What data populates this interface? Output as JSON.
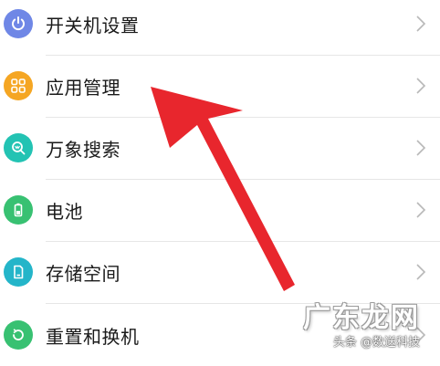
{
  "settings": {
    "items": [
      {
        "label": "开关机设置",
        "icon": "power-icon",
        "color": "#6f87e6"
      },
      {
        "label": "应用管理",
        "icon": "apps-grid-icon",
        "color": "#f5a623"
      },
      {
        "label": "万象搜索",
        "icon": "search-icon",
        "color": "#23c3b3"
      },
      {
        "label": "电池",
        "icon": "battery-icon",
        "color": "#38c172"
      },
      {
        "label": "存储空间",
        "icon": "storage-icon",
        "color": "#24b5c9"
      },
      {
        "label": "重置和换机",
        "icon": "reset-icon",
        "color": "#38c172"
      }
    ]
  },
  "annotation": {
    "arrow_color": "#e8262d"
  },
  "watermark": {
    "logo": "广东龙网",
    "sub": "头条 @数送科技"
  }
}
